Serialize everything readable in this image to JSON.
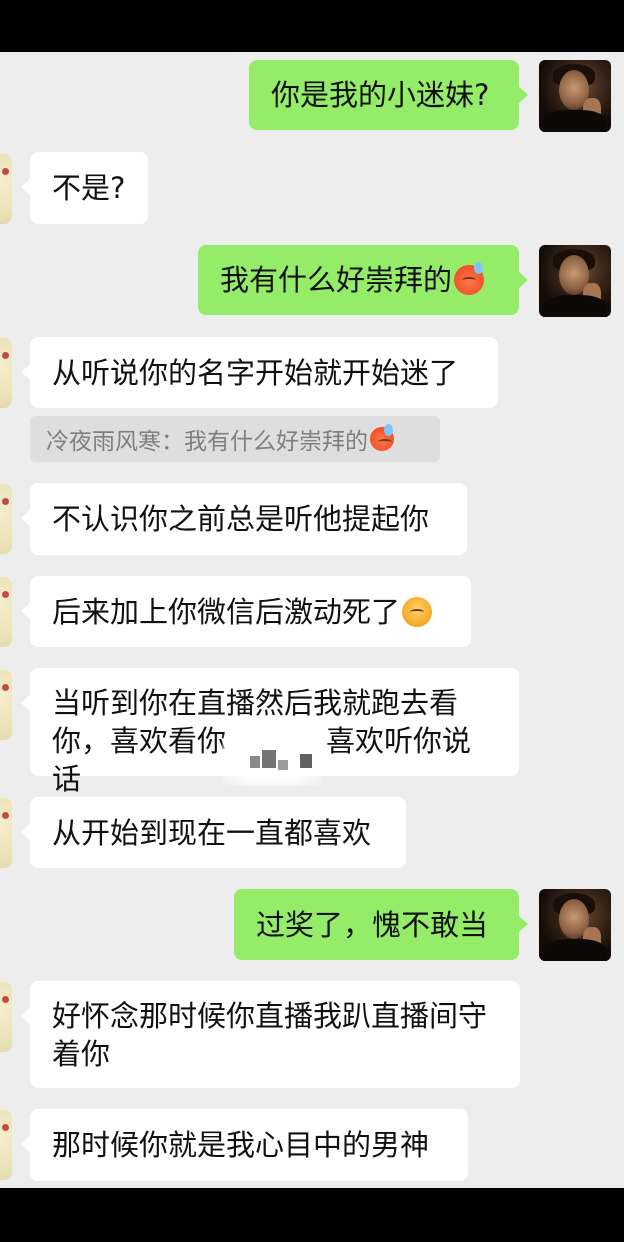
{
  "messages": [
    {
      "dir": "out",
      "text": "你是我的小迷妹?"
    },
    {
      "dir": "in",
      "text": "不是?"
    },
    {
      "dir": "out",
      "text": "我有什么好崇拜的",
      "emoji": "cold-sweat-emoji"
    },
    {
      "dir": "in",
      "text": "从听说你的名字开始就开始迷了"
    },
    {
      "quote": "冷夜雨风寒：我有什么好崇拜的",
      "emoji": "cold-sweat-emoji"
    },
    {
      "dir": "in",
      "text": "不认识你之前总是听他提起你"
    },
    {
      "dir": "in",
      "text": "后来加上你微信后激动死了",
      "emoji": "blush-emoji"
    },
    {
      "dir": "in",
      "lines": [
        "当听到你在直播然后我就跑去看",
        "你，喜欢看你",
        "喜欢听你说话"
      ],
      "note": "partially obscured by blur mosaic"
    },
    {
      "dir": "in",
      "text": "从开始到现在一直都喜欢"
    },
    {
      "dir": "out",
      "text": "过奖了，愧不敢当"
    },
    {
      "dir": "in",
      "lines": [
        "好怀念那时候你直播我趴直播间守",
        "着你"
      ]
    },
    {
      "dir": "in",
      "text": "那时候你就是我心目中的男神"
    }
  ],
  "colors": {
    "incoming": "#ffffff",
    "outgoing": "#95ec69",
    "background": "#ededed",
    "quote": "#dedede"
  }
}
